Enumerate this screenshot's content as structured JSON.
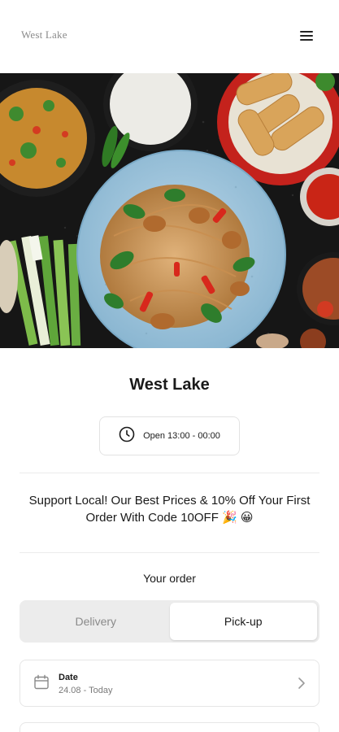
{
  "header": {
    "brand": "West Lake",
    "menu_icon": "hamburger-menu-icon"
  },
  "hero": {
    "image_subject": "noodles-spring-rolls-rice-dishes"
  },
  "restaurant": {
    "name": "West Lake",
    "hours": "Open 13:00 - 00:00",
    "clock_icon": "clock-icon"
  },
  "promo": {
    "text": "Support Local! Our Best Prices & 10% Off Your First Order With Code 10OFF 🎉 😀"
  },
  "order": {
    "heading": "Your order",
    "modes": [
      {
        "label": "Delivery",
        "selected": false
      },
      {
        "label": "Pick-up",
        "selected": true
      }
    ],
    "date": {
      "label": "Date",
      "value": "24.08 - Today",
      "icon": "calendar-icon",
      "chevron": "chevron-right-icon"
    }
  },
  "colors": {
    "text": "#1a1a1a",
    "muted": "#8a8a8a",
    "border": "#e6e6e6",
    "toggle_bg": "#ececec",
    "plate_blue": "#9ec6de"
  }
}
